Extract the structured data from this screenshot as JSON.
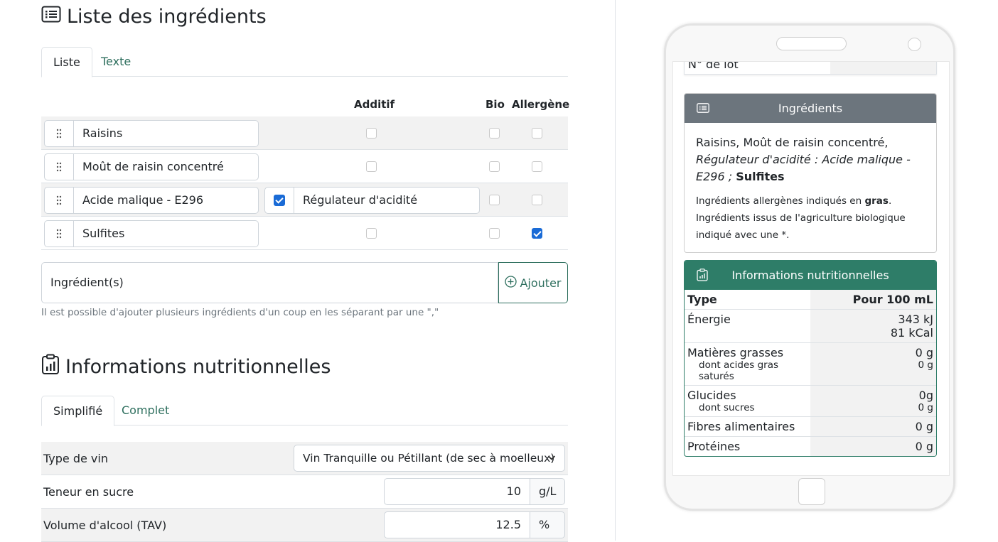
{
  "ingredients_section": {
    "title": "Liste des ingrédients",
    "tabs": [
      "Liste",
      "Texte"
    ],
    "columns": {
      "additif": "Additif",
      "bio": "Bio",
      "allergene": "Allergène"
    },
    "rows": [
      {
        "name": "Raisins",
        "additif": false,
        "bio": false,
        "allergene": false,
        "additif_label": ""
      },
      {
        "name": "Moût de raisin concentré",
        "additif": false,
        "bio": false,
        "allergene": false,
        "additif_label": ""
      },
      {
        "name": "Acide malique - E296",
        "additif": true,
        "bio": false,
        "allergene": false,
        "additif_label": "Régulateur d'acidité"
      },
      {
        "name": "Sulfites",
        "additif": false,
        "bio": false,
        "allergene": true,
        "additif_label": ""
      }
    ],
    "add_placeholder": "Ingrédient(s)",
    "add_button": "Ajouter",
    "help": "Il est possible d'ajouter plusieurs ingrédients d'un coup en les séparant par une \",\""
  },
  "nutrition_section": {
    "title": "Informations nutritionnelles",
    "tabs": [
      "Simplifié",
      "Complet"
    ],
    "wine_type_label": "Type de vin",
    "wine_type_value": "Vin Tranquille ou Pétillant (de sec à moelleux)",
    "sugar_label": "Teneur en sucre",
    "sugar_value": "10",
    "sugar_unit": "g/L",
    "alcohol_label": "Volume d'alcool (TAV)",
    "alcohol_value": "12.5",
    "alcohol_unit": "%"
  },
  "preview": {
    "lot_label": "N° de lot",
    "ingredients_card": {
      "title": "Ingrédients",
      "color": "#6c757d",
      "text_plain": "Raisins, Moût de raisin concentré, ",
      "text_italic": "Régulateur d'acidité : Acide malique - E296 ;",
      "text_bold": "Sulfites",
      "note1_a": "Ingrédients allergènes indiqués en ",
      "note1_b": "gras",
      "note1_c": ".",
      "note2": "Ingrédients issus de l'agriculture biologique indiqué avec une *."
    },
    "nutrition_card": {
      "title": "Informations nutritionnelles",
      "color": "#2e7d68",
      "header_type": "Type",
      "header_value": "Pour 100 mL",
      "energy_label": "Énergie",
      "energy_kj": "343 kJ",
      "energy_kcal": "81 kCal",
      "fat_label": "Matières grasses",
      "fat_value": "0 g",
      "sat_label": "dont acides gras saturés",
      "sat_value": "0 g",
      "carb_label": "Glucides",
      "carb_value": "0g",
      "sugar_label": "dont sucres",
      "sugar_value": "0 g",
      "fiber_label": "Fibres alimentaires",
      "fiber_value": "0 g",
      "protein_label": "Protéines",
      "protein_value": "0 g"
    }
  }
}
